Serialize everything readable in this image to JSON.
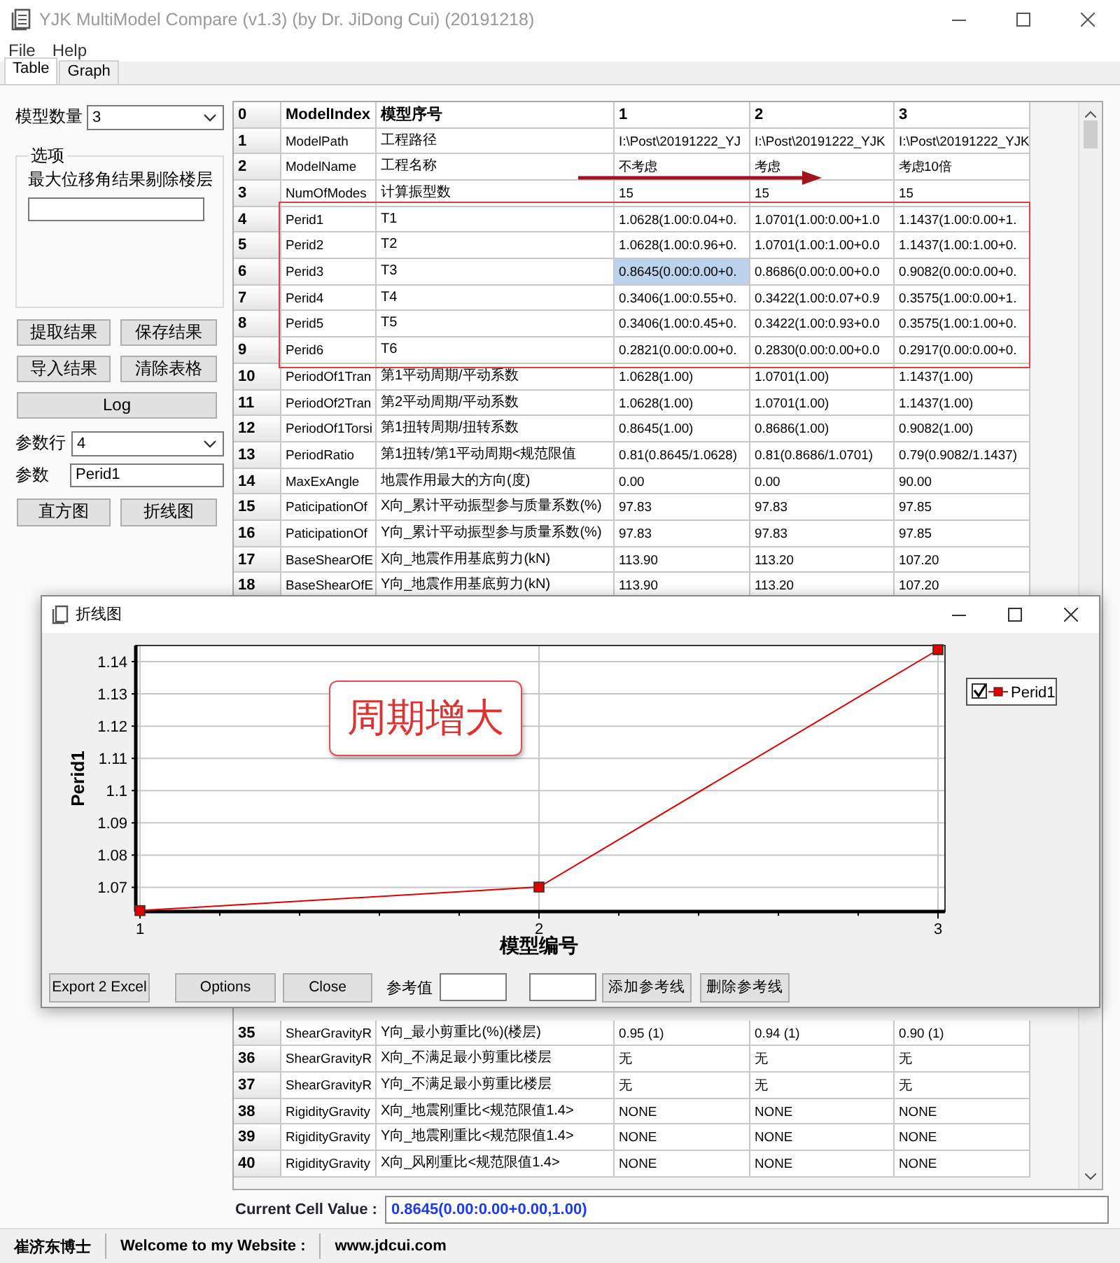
{
  "window": {
    "title": "YJK MultiModel Compare (v1.3) (by Dr. JiDong Cui) (20191218)"
  },
  "menu": [
    "File",
    "Help"
  ],
  "tabs": [
    {
      "label": "Table",
      "selected": true
    },
    {
      "label": "Graph",
      "selected": false
    }
  ],
  "left_panel": {
    "model_count_label": "模型数量",
    "model_count_value": "3",
    "options_group": {
      "title": "选项",
      "label": "最大位移角结果剔除楼层"
    },
    "buttons": [
      "提取结果",
      "保存结果",
      "导入结果",
      "清除表格"
    ],
    "log_button": "Log",
    "param_row_label": "参数行",
    "param_row_value": "4",
    "param_label": "参数",
    "param_value": "Perid1",
    "chart_buttons": [
      "直方图",
      "折线图"
    ]
  },
  "table": {
    "annotations": {
      "frame": true,
      "arrow": true
    },
    "row_groups": [
      [
        {
          "cells": [
            "0",
            "ModelIndex",
            "模型序号",
            "1",
            "2",
            "3"
          ],
          "cell_selected": [
            false,
            false,
            false,
            false,
            false,
            false
          ]
        },
        {
          "cells": [
            "1",
            "ModelPath",
            "工程路径",
            "I:\\Post\\20191222_YJ",
            "I:\\Post\\20191222_YJK",
            "I:\\Post\\20191222_YJK"
          ],
          "cell_selected": [
            false,
            false,
            false,
            false,
            false,
            false
          ]
        },
        {
          "cells": [
            "2",
            "ModelName",
            "工程名称",
            "不考虑",
            "考虑",
            "考虑10倍"
          ],
          "cell_selected": [
            false,
            false,
            false,
            false,
            false,
            false
          ]
        },
        {
          "cells": [
            "3",
            "NumOfModes",
            "计算振型数",
            "15",
            "15",
            "15"
          ],
          "cell_selected": [
            false,
            false,
            false,
            false,
            false,
            false
          ]
        },
        {
          "cells": [
            "4",
            "Perid1",
            "T1",
            "1.0628(1.00:0.04+0.",
            "1.0701(1.00:0.00+1.0",
            "1.1437(1.00:0.00+1."
          ],
          "cell_selected": [
            false,
            false,
            false,
            false,
            false,
            false
          ]
        },
        {
          "cells": [
            "5",
            "Perid2",
            "T2",
            "1.0628(1.00:0.96+0.",
            "1.0701(1.00:1.00+0.0",
            "1.1437(1.00:1.00+0."
          ],
          "cell_selected": [
            false,
            false,
            false,
            false,
            false,
            false
          ]
        },
        {
          "cells": [
            "6",
            "Perid3",
            "T3",
            "0.8645(0.00:0.00+0.",
            "0.8686(0.00:0.00+0.0",
            "0.9082(0.00:0.00+0."
          ],
          "cell_selected": [
            false,
            false,
            false,
            true,
            false,
            false
          ]
        },
        {
          "cells": [
            "7",
            "Perid4",
            "T4",
            "0.3406(1.00:0.55+0.",
            "0.3422(1.00:0.07+0.9",
            "0.3575(1.00:0.00+1."
          ],
          "cell_selected": [
            false,
            false,
            false,
            false,
            false,
            false
          ]
        },
        {
          "cells": [
            "8",
            "Perid5",
            "T5",
            "0.3406(1.00:0.45+0.",
            "0.3422(1.00:0.93+0.0",
            "0.3575(1.00:1.00+0."
          ],
          "cell_selected": [
            false,
            false,
            false,
            false,
            false,
            false
          ]
        },
        {
          "cells": [
            "9",
            "Perid6",
            "T6",
            "0.2821(0.00:0.00+0.",
            "0.2830(0.00:0.00+0.0",
            "0.2917(0.00:0.00+0."
          ],
          "cell_selected": [
            false,
            false,
            false,
            false,
            false,
            false
          ]
        },
        {
          "cells": [
            "10",
            "PeriodOf1Tran",
            "第1平动周期/平动系数",
            "1.0628(1.00)",
            "1.0701(1.00)",
            "1.1437(1.00)"
          ],
          "cell_selected": [
            false,
            false,
            false,
            false,
            false,
            false
          ]
        },
        {
          "cells": [
            "11",
            "PeriodOf2Tran",
            "第2平动周期/平动系数",
            "1.0628(1.00)",
            "1.0701(1.00)",
            "1.1437(1.00)"
          ],
          "cell_selected": [
            false,
            false,
            false,
            false,
            false,
            false
          ]
        },
        {
          "cells": [
            "12",
            "PeriodOf1Torsi",
            "第1扭转周期/扭转系数",
            "0.8645(1.00)",
            "0.8686(1.00)",
            "0.9082(1.00)"
          ],
          "cell_selected": [
            false,
            false,
            false,
            false,
            false,
            false
          ]
        },
        {
          "cells": [
            "13",
            "PeriodRatio",
            "第1扭转/第1平动周期<规范限值",
            "0.81(0.8645/1.0628)",
            "0.81(0.8686/1.0701)",
            "0.79(0.9082/1.1437)"
          ],
          "cell_selected": [
            false,
            false,
            false,
            false,
            false,
            false
          ]
        },
        {
          "cells": [
            "14",
            "MaxExAngle",
            "地震作用最大的方向(度)",
            "0.00",
            "0.00",
            "90.00"
          ],
          "cell_selected": [
            false,
            false,
            false,
            false,
            false,
            false
          ]
        },
        {
          "cells": [
            "15",
            "PaticipationOf",
            "X向_累计平动振型参与质量系数(%)",
            "97.83",
            "97.83",
            "97.85"
          ],
          "cell_selected": [
            false,
            false,
            false,
            false,
            false,
            false
          ]
        },
        {
          "cells": [
            "16",
            "PaticipationOf",
            "Y向_累计平动振型参与质量系数(%)",
            "97.83",
            "97.83",
            "97.85"
          ],
          "cell_selected": [
            false,
            false,
            false,
            false,
            false,
            false
          ]
        },
        {
          "cells": [
            "17",
            "BaseShearOfE",
            "X向_地震作用基底剪力(kN)",
            "113.90",
            "113.20",
            "107.20"
          ],
          "cell_selected": [
            false,
            false,
            false,
            false,
            false,
            false
          ]
        },
        {
          "cells": [
            "18",
            "BaseShearOfE",
            "Y向_地震作用基底剪力(kN)",
            "113.90",
            "113.20",
            "107.20"
          ],
          "cell_selected": [
            false,
            false,
            false,
            false,
            false,
            false
          ]
        }
      ],
      [
        {
          "cells": [
            "35",
            "ShearGravityR",
            "Y向_最小剪重比(%)(楼层)",
            "0.95 (1)",
            "0.94 (1)",
            "0.90 (1)"
          ],
          "cell_selected": [
            false,
            false,
            false,
            false,
            false,
            false
          ]
        },
        {
          "cells": [
            "36",
            "ShearGravityR",
            "X向_不满足最小剪重比楼层",
            "无",
            "无",
            "无"
          ],
          "cell_selected": [
            false,
            false,
            false,
            false,
            false,
            false
          ]
        },
        {
          "cells": [
            "37",
            "ShearGravityR",
            "Y向_不满足最小剪重比楼层",
            "无",
            "无",
            "无"
          ],
          "cell_selected": [
            false,
            false,
            false,
            false,
            false,
            false
          ]
        },
        {
          "cells": [
            "38",
            "RigidityGravity",
            "X向_地震刚重比<规范限值1.4>",
            "NONE",
            "NONE",
            "NONE"
          ],
          "cell_selected": [
            false,
            false,
            false,
            false,
            false,
            false
          ]
        },
        {
          "cells": [
            "39",
            "RigidityGravity",
            "Y向_地震刚重比<规范限值1.4>",
            "NONE",
            "NONE",
            "NONE"
          ],
          "cell_selected": [
            false,
            false,
            false,
            false,
            false,
            false
          ]
        },
        {
          "cells": [
            "40",
            "RigidityGravity",
            "X向_风刚重比<规范限值1.4>",
            "NONE",
            "NONE",
            "NONE"
          ],
          "cell_selected": [
            false,
            false,
            false,
            false,
            false,
            false
          ]
        }
      ]
    ]
  },
  "current_cell": {
    "label": "Current Cell Value :",
    "value": "0.8645(0.00:0.00+0.00,1.00)"
  },
  "status_bar": [
    "崔济东博士",
    "Welcome to my Website :",
    "www.jdcui.com"
  ],
  "dialog": {
    "title": "折线图",
    "callout": "周期增大",
    "legend_checked": true,
    "chart_data": {
      "type": "line",
      "xlabel": "模型编号",
      "ylabel": "Perid1",
      "x": [
        1,
        2,
        3
      ],
      "series": [
        {
          "name": "Perid1",
          "color": "#e00000",
          "marker": "square",
          "values": [
            1.0628,
            1.0701,
            1.1437
          ]
        }
      ],
      "grid": true,
      "xlim": [
        1,
        3
      ],
      "ylim": [
        1.0625,
        1.145
      ],
      "xticks": [
        1,
        2,
        3
      ],
      "yticks": [
        1.07,
        1.08,
        1.09,
        1.1,
        1.11,
        1.12,
        1.13,
        1.14
      ]
    },
    "buttons": [
      "Export 2 Excel",
      "Options",
      "Close"
    ],
    "ref_label": "参考值",
    "ref_buttons": [
      "添加参考线",
      "删除参考线"
    ]
  }
}
